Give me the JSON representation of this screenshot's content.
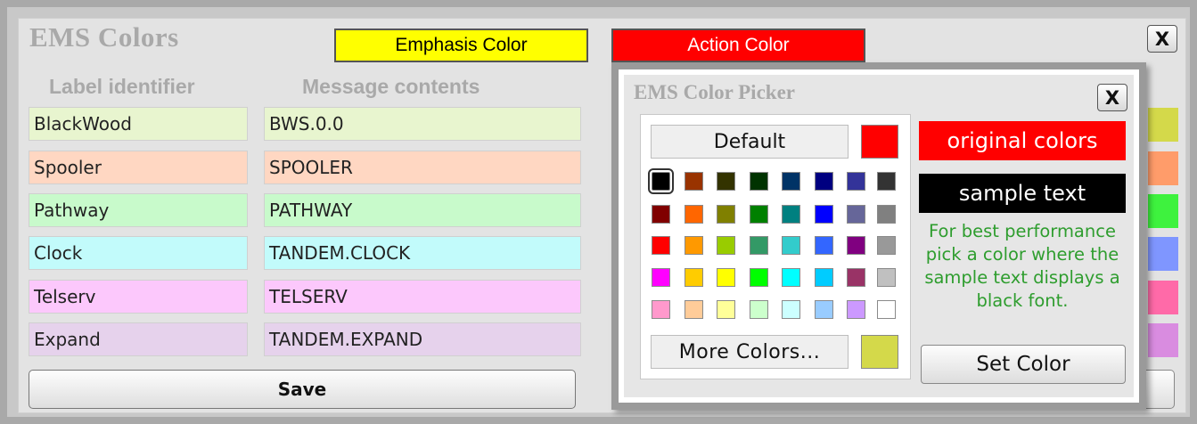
{
  "window": {
    "title": "EMS Colors",
    "close_label": "X"
  },
  "header_buttons": {
    "emphasis_label": "Emphasis Color",
    "emphasis_color": "#ffff00",
    "action_label": "Action Color",
    "action_color": "#ff0000"
  },
  "columns": {
    "label_header": "Label identifier",
    "message_header": "Message contents"
  },
  "rows": [
    {
      "label": "BlackWood",
      "message": "BWS.0.0",
      "bg": "#e8f5cf",
      "swatch": "#d4d94a"
    },
    {
      "label": "Spooler",
      "message": "SPOOLER",
      "bg": "#ffd7c2",
      "swatch": "#ff9c6a"
    },
    {
      "label": "Pathway",
      "message": "PATHWAY",
      "bg": "#c8facb",
      "swatch": "#3ef23e"
    },
    {
      "label": "Clock",
      "message": "TANDEM.CLOCK",
      "bg": "#c2fbfb",
      "swatch": "#7f96ff"
    },
    {
      "label": "Telserv",
      "message": "TELSERV",
      "bg": "#fcc8fc",
      "swatch": "#ff6aa8"
    },
    {
      "label": "Expand",
      "message": "TANDEM.EXPAND",
      "bg": "#e6d2ec",
      "swatch": "#d98ce0"
    }
  ],
  "save_label": "Save",
  "picker": {
    "title": "EMS Color Picker",
    "close_label": "X",
    "default_label": "Default",
    "default_swatch": "#ff0000",
    "more_label": "More Colors...",
    "more_swatch": "#d4d94a",
    "original_label": "original colors",
    "sample_label": "sample text",
    "hint": "For best performance pick a color where the sample text displays a black font.",
    "set_label": "Set Color",
    "palette": [
      [
        "#000000",
        "#993300",
        "#333300",
        "#003300",
        "#003366",
        "#000080",
        "#333399",
        "#333333"
      ],
      [
        "#800000",
        "#ff6600",
        "#808000",
        "#008000",
        "#008080",
        "#0000ff",
        "#666699",
        "#808080"
      ],
      [
        "#ff0000",
        "#ff9900",
        "#99cc00",
        "#339966",
        "#33cccc",
        "#3366ff",
        "#800080",
        "#999999"
      ],
      [
        "#ff00ff",
        "#ffcc00",
        "#ffff00",
        "#00ff00",
        "#00ffff",
        "#00ccff",
        "#993366",
        "#c0c0c0"
      ],
      [
        "#ff99cc",
        "#ffcc99",
        "#ffff99",
        "#ccffcc",
        "#ccffff",
        "#99ccff",
        "#cc99ff",
        "#ffffff"
      ]
    ],
    "selected_swatch": "#000000"
  }
}
